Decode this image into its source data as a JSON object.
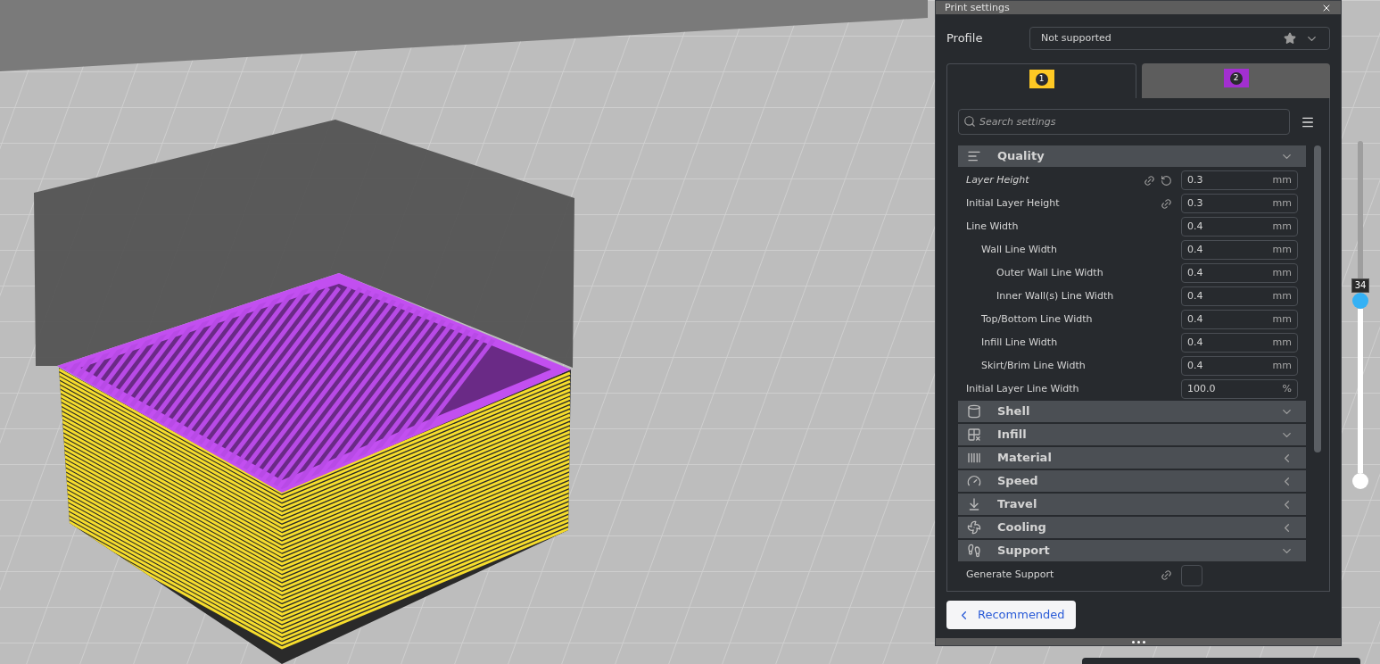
{
  "panel": {
    "title": "Print settings",
    "profile": {
      "label": "Profile",
      "value": "Not supported"
    },
    "extruder_tabs": [
      {
        "number": "1",
        "color": "#ffc924",
        "selected": true
      },
      {
        "number": "2",
        "color": "#a22fd0",
        "selected": false
      }
    ],
    "search": {
      "placeholder": "Search settings"
    },
    "categories": [
      {
        "name": "Quality",
        "expanded": true,
        "settings": [
          {
            "kind": "number",
            "label": "Layer Height",
            "value": "0.3",
            "unit": "mm",
            "modified": true,
            "linked": true
          },
          {
            "kind": "number",
            "label": "Initial Layer Height",
            "value": "0.3",
            "unit": "mm",
            "modified": false,
            "linked": true
          },
          {
            "kind": "number",
            "label": "Line Width",
            "value": "0.4",
            "unit": "mm",
            "modified": false,
            "linked": false,
            "children": [
              {
                "kind": "number",
                "label": "Wall Line Width",
                "value": "0.4",
                "unit": "mm",
                "modified": false,
                "linked": false,
                "children": [
                  {
                    "kind": "number",
                    "label": "Outer Wall Line Width",
                    "value": "0.4",
                    "unit": "mm",
                    "modified": false,
                    "linked": false
                  },
                  {
                    "kind": "number",
                    "label": "Inner Wall(s) Line Width",
                    "value": "0.4",
                    "unit": "mm",
                    "modified": false,
                    "linked": false
                  }
                ]
              },
              {
                "kind": "number",
                "label": "Top/Bottom Line Width",
                "value": "0.4",
                "unit": "mm",
                "modified": false,
                "linked": false
              },
              {
                "kind": "number",
                "label": "Infill Line Width",
                "value": "0.4",
                "unit": "mm",
                "modified": false,
                "linked": false
              },
              {
                "kind": "number",
                "label": "Skirt/Brim Line Width",
                "value": "0.4",
                "unit": "mm",
                "modified": false,
                "linked": false
              }
            ]
          },
          {
            "kind": "number",
            "label": "Initial Layer Line Width",
            "value": "100.0",
            "unit": "%",
            "modified": false,
            "linked": false
          }
        ]
      },
      {
        "name": "Shell",
        "expanded": true
      },
      {
        "name": "Infill",
        "expanded": true
      },
      {
        "name": "Material",
        "expanded": false
      },
      {
        "name": "Speed",
        "expanded": false
      },
      {
        "name": "Travel",
        "expanded": false
      },
      {
        "name": "Cooling",
        "expanded": false
      },
      {
        "name": "Support",
        "expanded": true,
        "settings": [
          {
            "kind": "checkbox",
            "label": "Generate Support",
            "checked": false,
            "modified": false,
            "linked": true
          }
        ]
      }
    ],
    "mode_button": "Recommended"
  },
  "layer_slider": {
    "value": "34",
    "level": 0.54
  }
}
